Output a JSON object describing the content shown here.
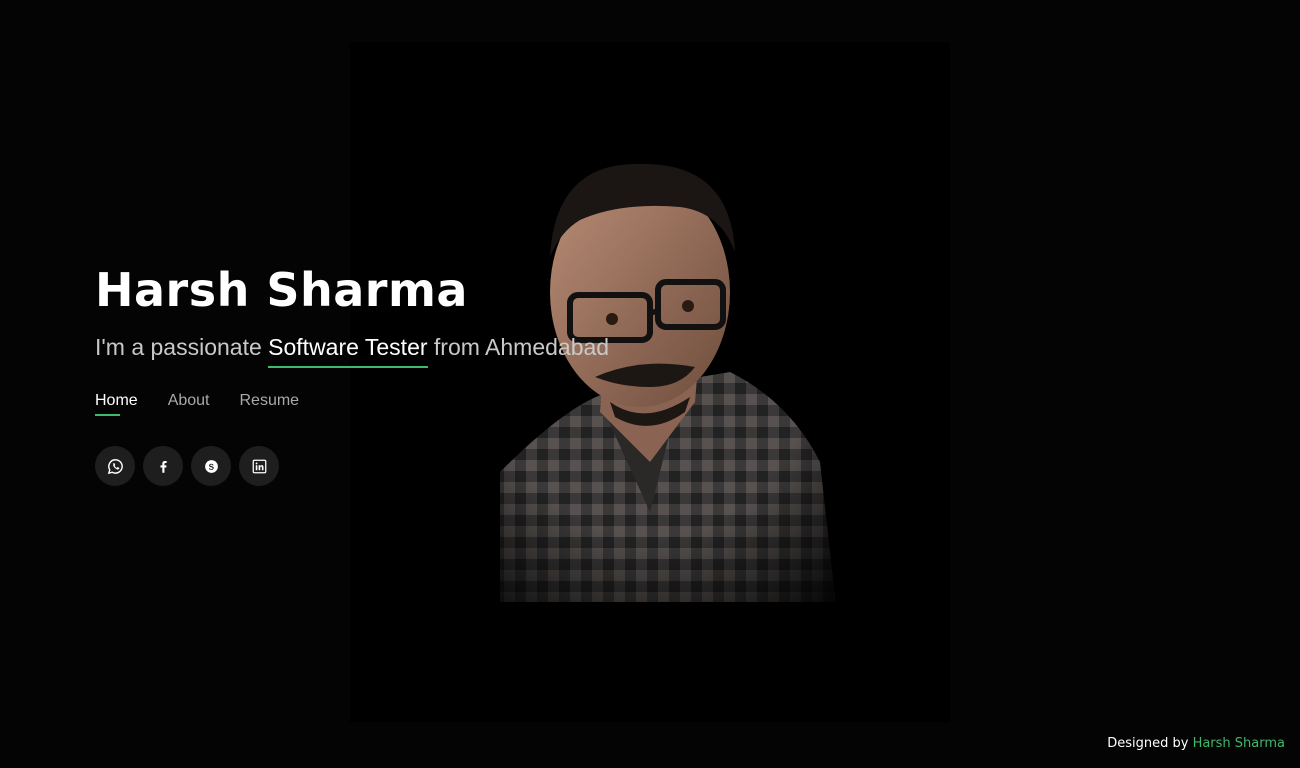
{
  "hero": {
    "name": "Harsh Sharma",
    "tagline_prefix": "I'm a passionate ",
    "tagline_role": "Software Tester",
    "tagline_suffix": " from Ahmedabad"
  },
  "nav": {
    "items": [
      {
        "label": "Home",
        "active": true
      },
      {
        "label": "About",
        "active": false
      },
      {
        "label": "Resume",
        "active": false
      }
    ]
  },
  "socials": [
    {
      "icon": "whatsapp-icon"
    },
    {
      "icon": "facebook-icon"
    },
    {
      "icon": "skype-icon"
    },
    {
      "icon": "linkedin-icon"
    }
  ],
  "footer": {
    "prefix": "Designed by ",
    "credit": "Harsh Sharma"
  },
  "colors": {
    "accent": "#3fb96a",
    "background": "#040404",
    "social_bg": "#1e1e1e"
  }
}
